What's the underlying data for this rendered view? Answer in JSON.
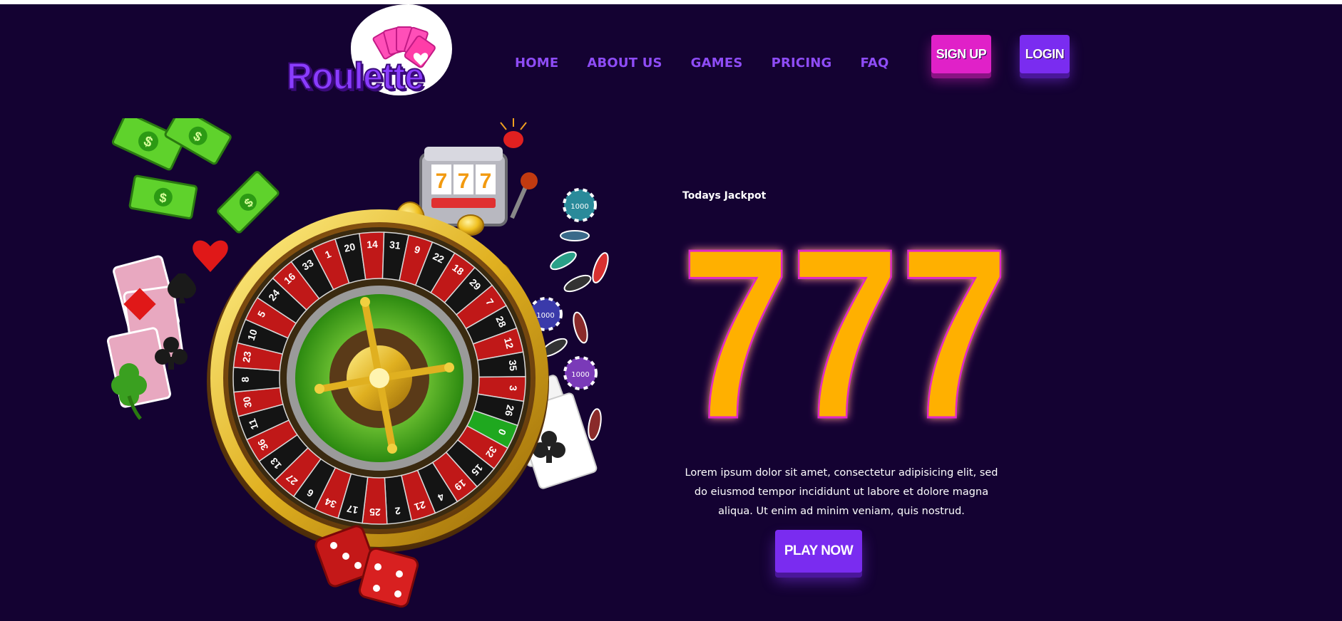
{
  "brand": {
    "logo_text": "Roulette"
  },
  "nav": {
    "items": [
      "HOME",
      "ABOUT US",
      "GAMES",
      "PRICING",
      "FAQ"
    ]
  },
  "header": {
    "signup_label": "SIGN UP",
    "login_label": "LOGIN"
  },
  "hero": {
    "jackpot_label": "Todays Jackpot",
    "jackpot_value": "777",
    "description": "Lorem ipsum dolor sit amet, consectetur adipisicing elit, sed do eiusmod tempor incididunt ut labore et dolore magna aliqua. Ut enim ad minim veniam, quis nostrud.",
    "play_label": "PLAY NOW"
  },
  "illustration": {
    "wheel_numbers": [
      "0",
      "32",
      "15",
      "19",
      "4",
      "21",
      "2",
      "25",
      "17",
      "34",
      "6",
      "27",
      "13",
      "36",
      "11",
      "30",
      "8",
      "23",
      "10",
      "5",
      "24",
      "16",
      "33",
      "1",
      "20",
      "14",
      "31",
      "9",
      "22",
      "18",
      "29",
      "7",
      "28",
      "12",
      "35",
      "3",
      "26"
    ],
    "chip_label": "1000",
    "slot_symbol": "7",
    "dollar_symbol": "$"
  },
  "colors": {
    "background": "#140232",
    "accent_purple": "#7a2cf0",
    "accent_pink": "#e021c8",
    "jackpot_gold": "#ffb000",
    "nav_text": "#8e4cf6"
  }
}
